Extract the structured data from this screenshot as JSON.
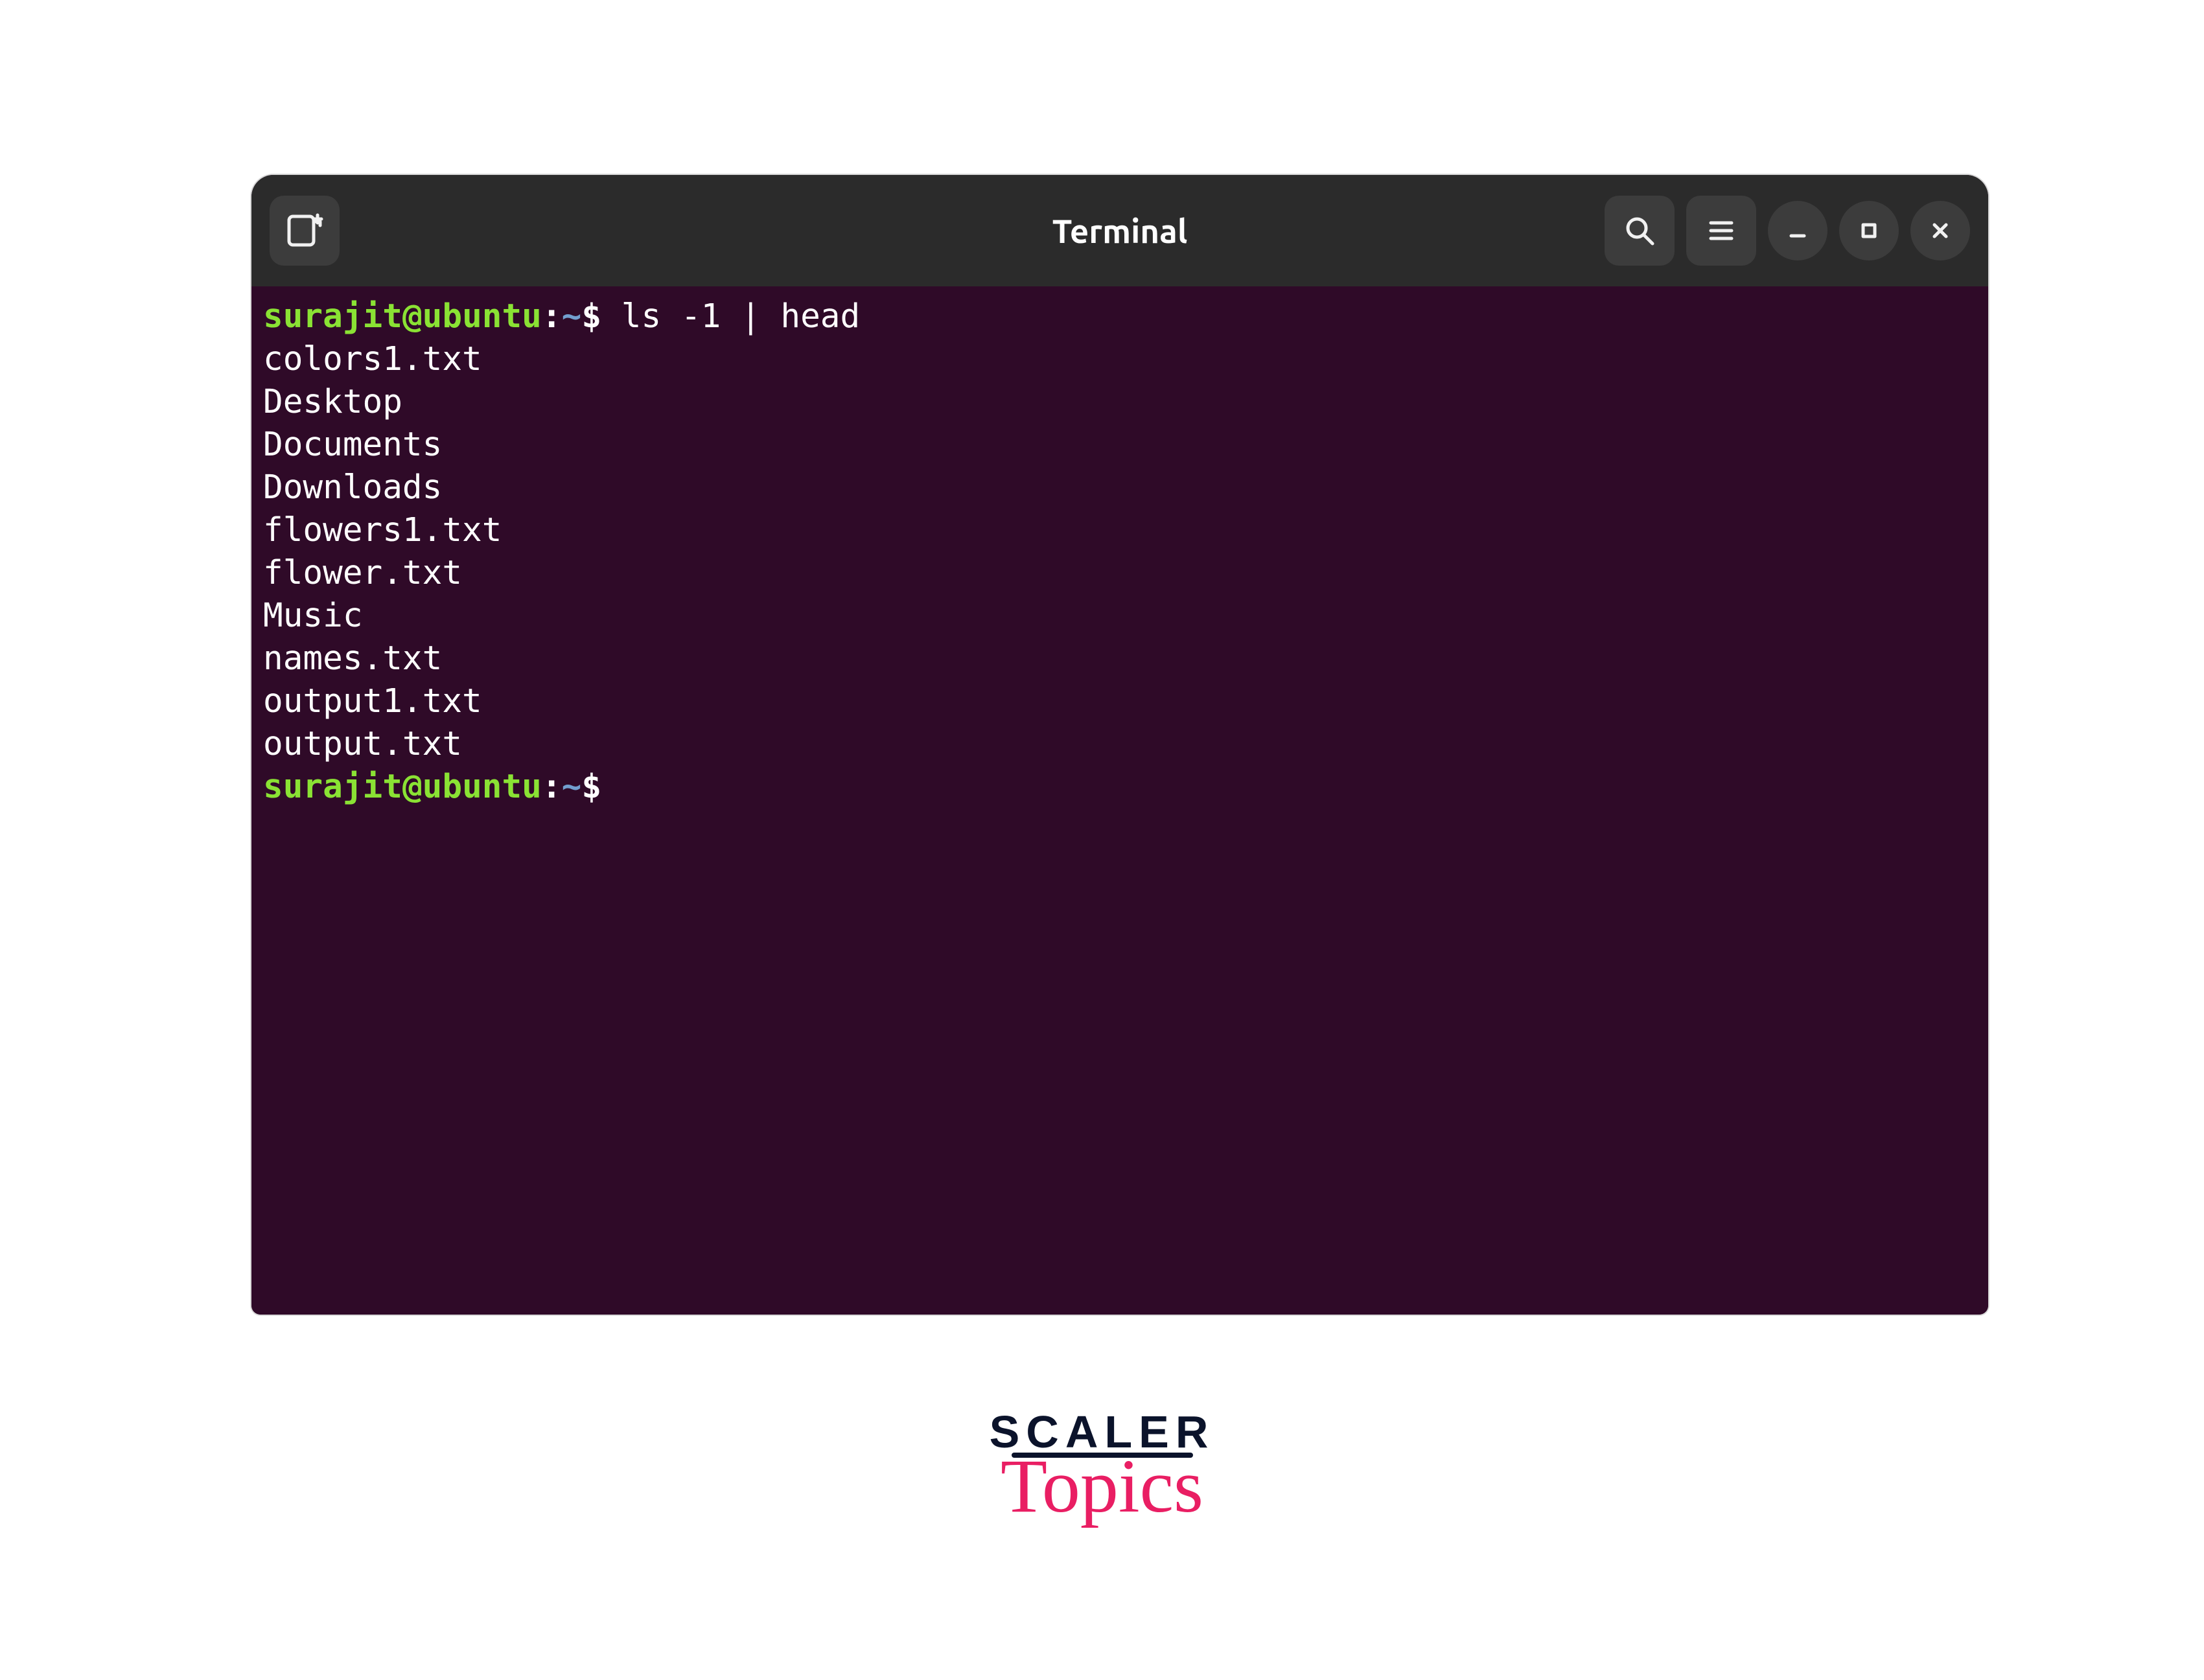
{
  "window": {
    "title": "Terminal"
  },
  "terminal": {
    "background": "#2f0a28",
    "foreground": "#ffffff",
    "prompt_user_color": "#8ae234",
    "prompt_path_color": "#729fcf",
    "prompt": {
      "user": "surajit",
      "host": "ubuntu",
      "path": "~",
      "symbol": "$"
    },
    "command": "ls -1 | head",
    "output_lines": [
      "colors1.txt",
      "Desktop",
      "Documents",
      "Downloads",
      "flowers1.txt",
      "flower.txt",
      "Music",
      "names.txt",
      "output1.txt",
      "output.txt"
    ]
  },
  "branding": {
    "line1": "SCALER",
    "line2": "Topics"
  }
}
